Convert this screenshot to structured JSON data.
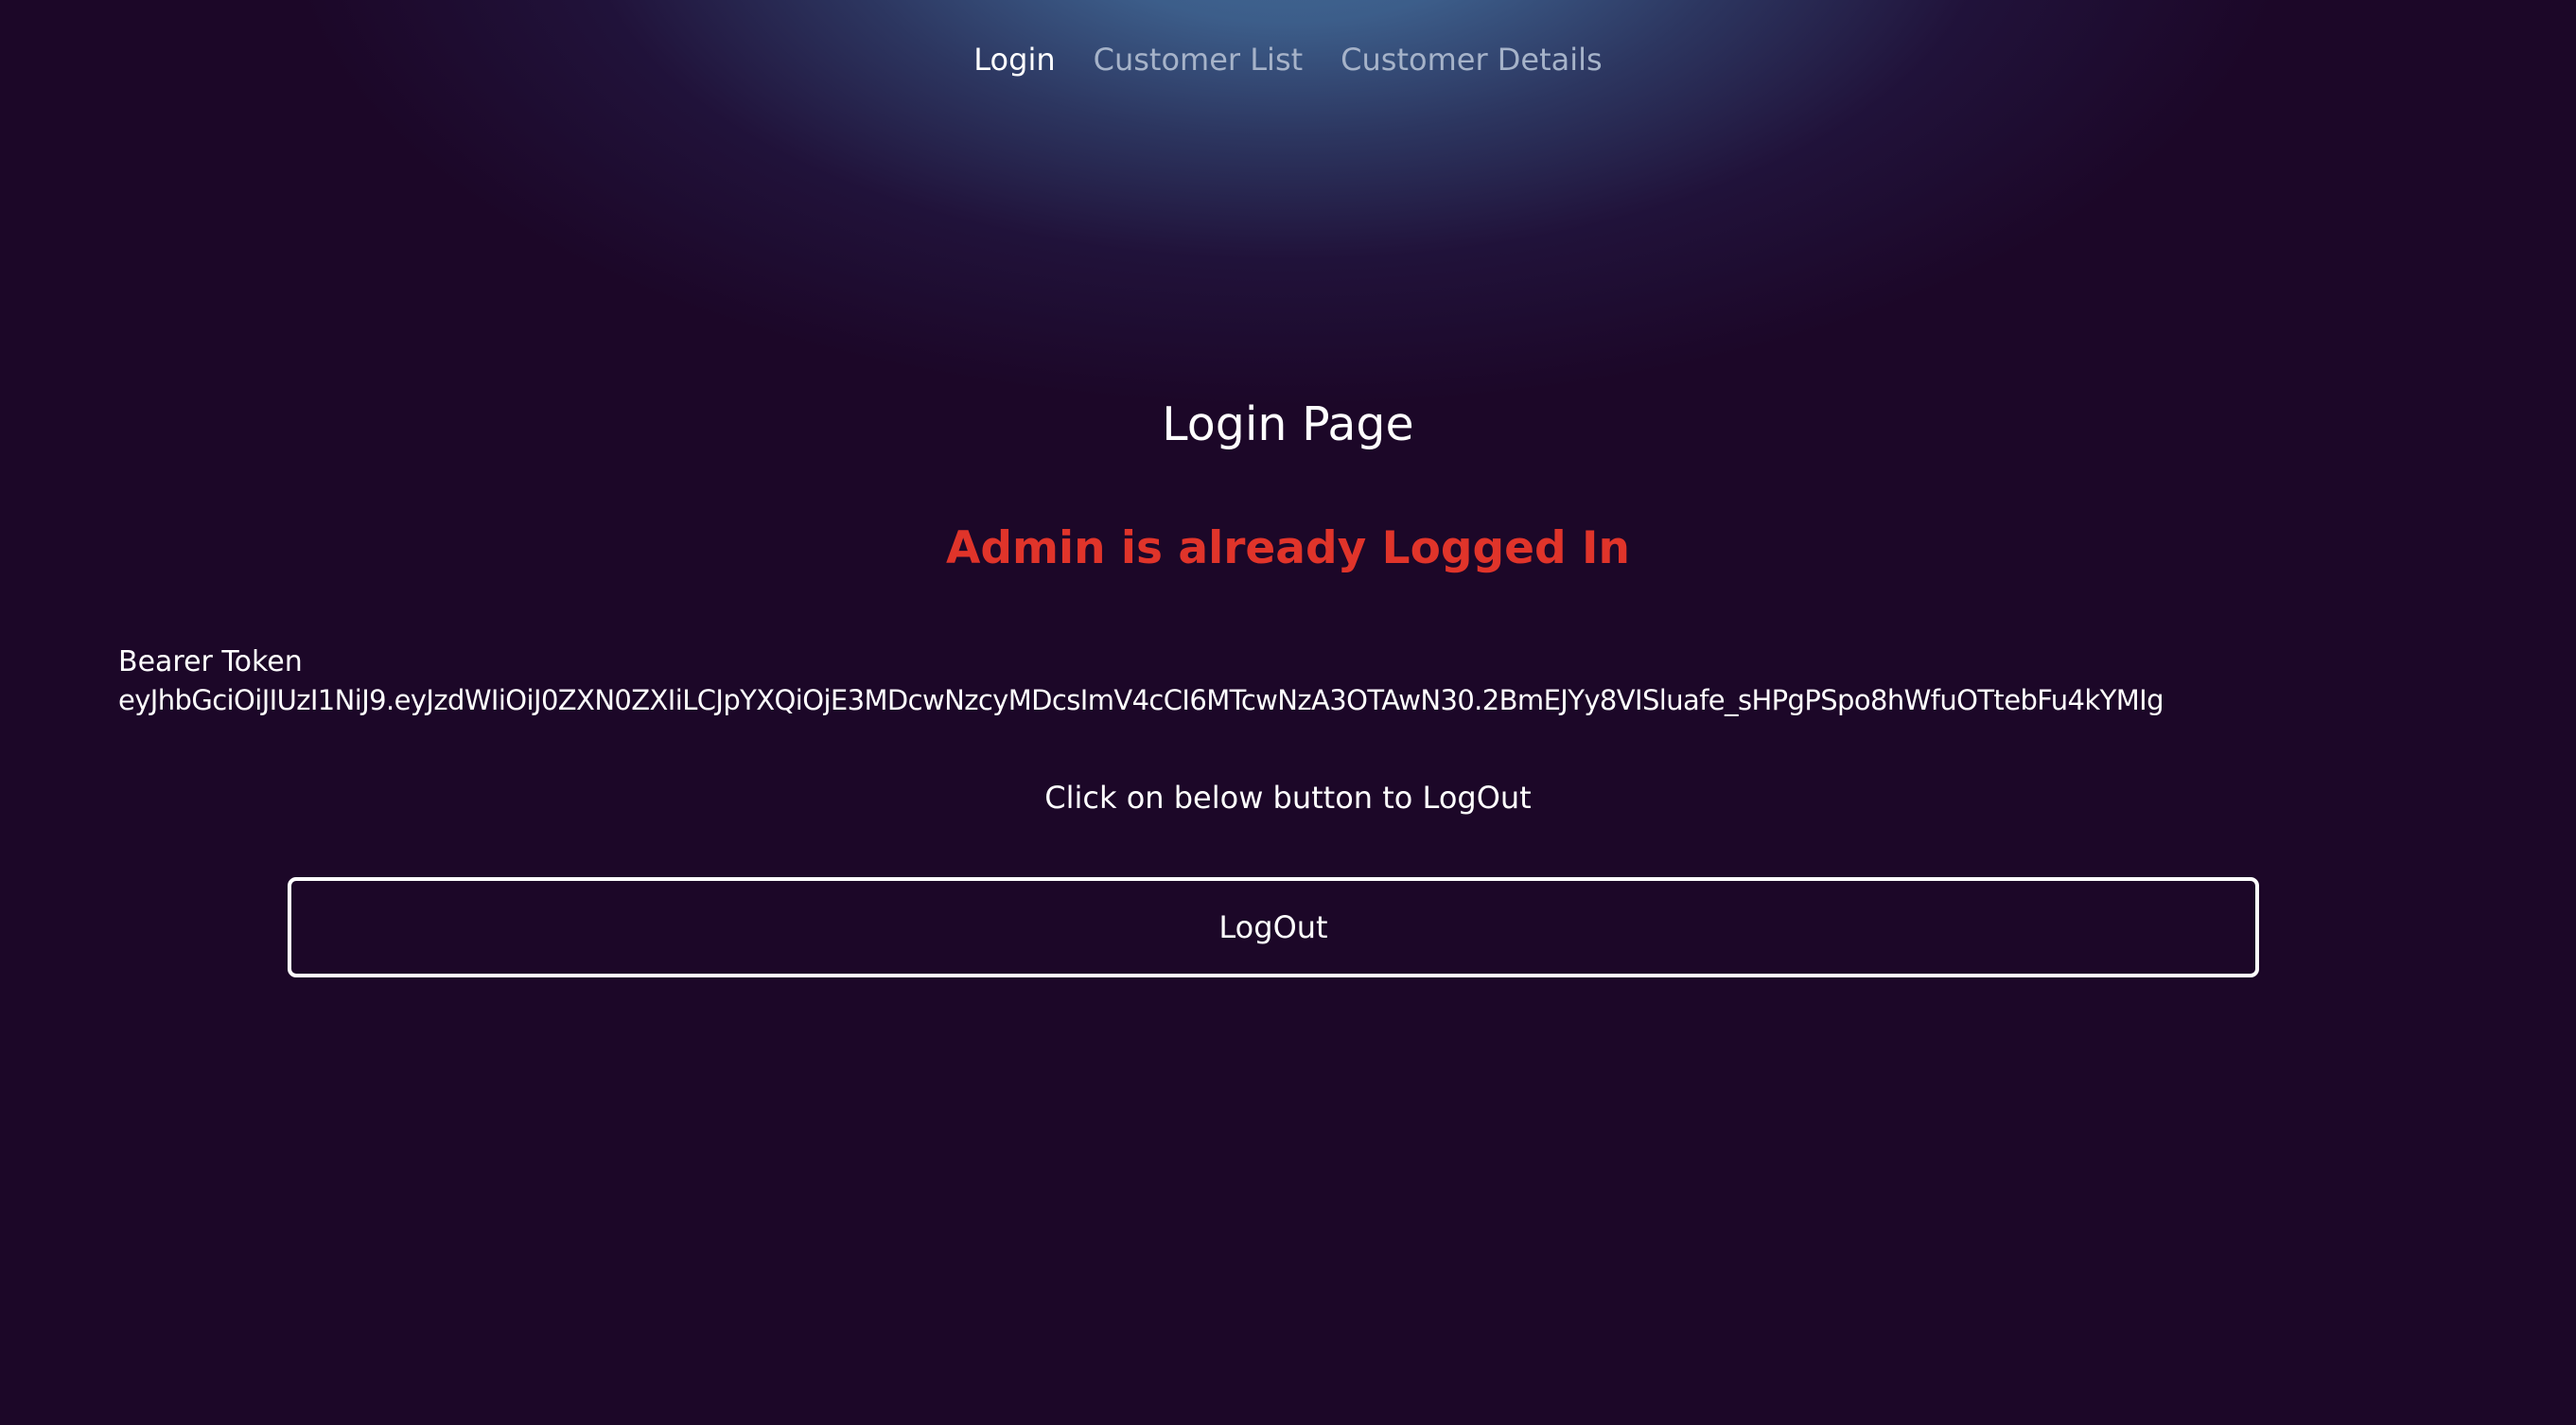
{
  "nav": {
    "items": [
      {
        "label": "Login",
        "active": true
      },
      {
        "label": "Customer List",
        "active": false
      },
      {
        "label": "Customer Details",
        "active": false
      }
    ]
  },
  "main": {
    "title": "Login Page",
    "status": "Admin is already Logged In",
    "token_label": "Bearer Token",
    "token_value": "eyJhbGciOiJIUzI1NiJ9.eyJzdWIiOiJ0ZXN0ZXIiLCJpYXQiOjE3MDcwNzcyMDcsImV4cCI6MTcwNzA3OTAwN30.2BmEJYy8VISluafe_sHPgPSpo8hWfuOTtebFu4kYMIg",
    "instruction": "Click on below button to LogOut",
    "logout_label": "LogOut"
  },
  "colors": {
    "background": "#1c0728",
    "status_red": "#e0342a",
    "nav_active": "#ffffff",
    "nav_inactive": "#a6b3c9"
  }
}
